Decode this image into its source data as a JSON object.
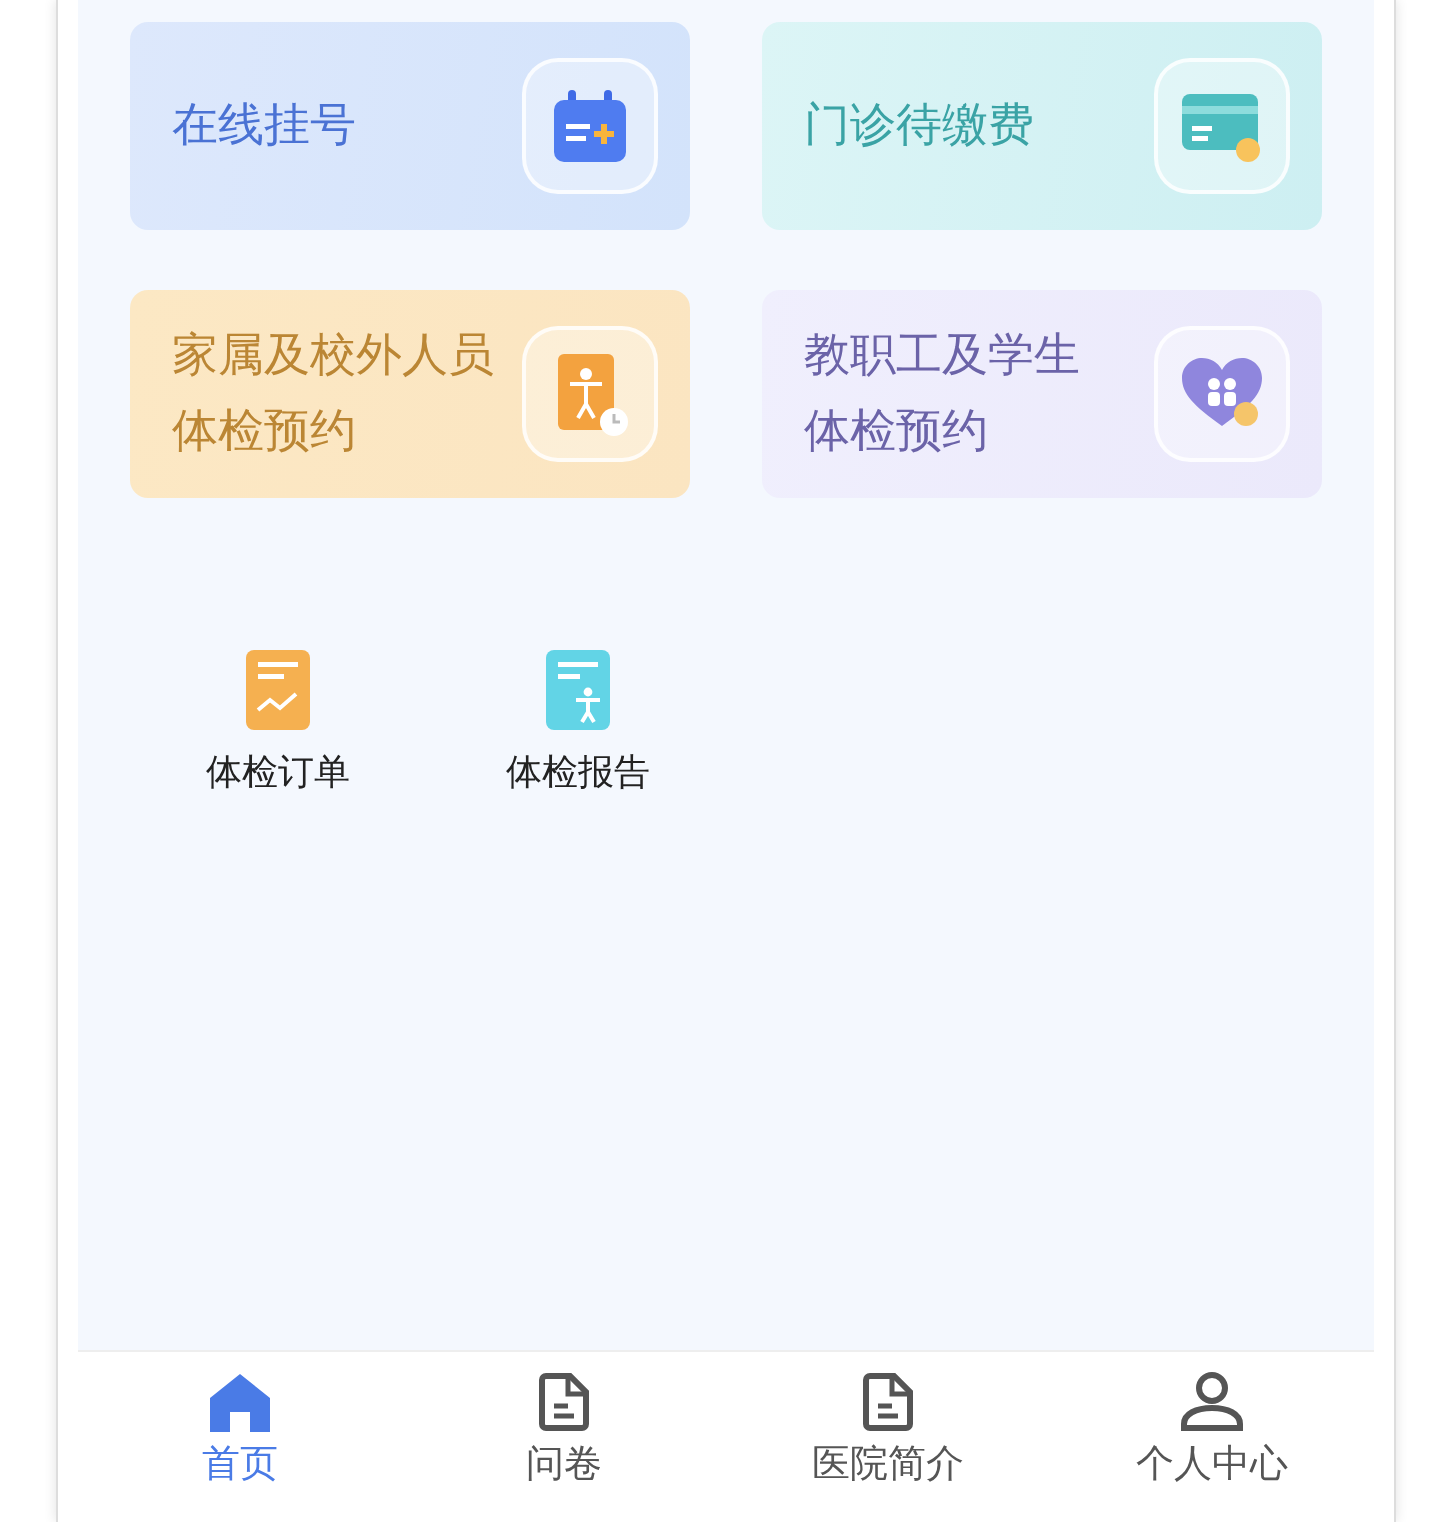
{
  "cards": [
    {
      "title": "在线挂号",
      "kind": "calendar"
    },
    {
      "title": "门诊待缴费",
      "kind": "payment"
    },
    {
      "lines": [
        "家属及校外人员",
        "体检预约"
      ],
      "kind": "body"
    },
    {
      "lines": [
        "教职工及学生",
        "体检预约"
      ],
      "kind": "heart"
    }
  ],
  "shortcuts": [
    {
      "label": "体检订单",
      "kind": "order"
    },
    {
      "label": "体检报告",
      "kind": "report"
    }
  ],
  "tab_bar": [
    {
      "label": "首页",
      "kind": "home",
      "selected": true
    },
    {
      "label": "问卷",
      "kind": "doc",
      "selected": false
    },
    {
      "label": "医院简介",
      "kind": "doc",
      "selected": false
    },
    {
      "label": "个人中心",
      "kind": "user",
      "selected": false
    }
  ]
}
